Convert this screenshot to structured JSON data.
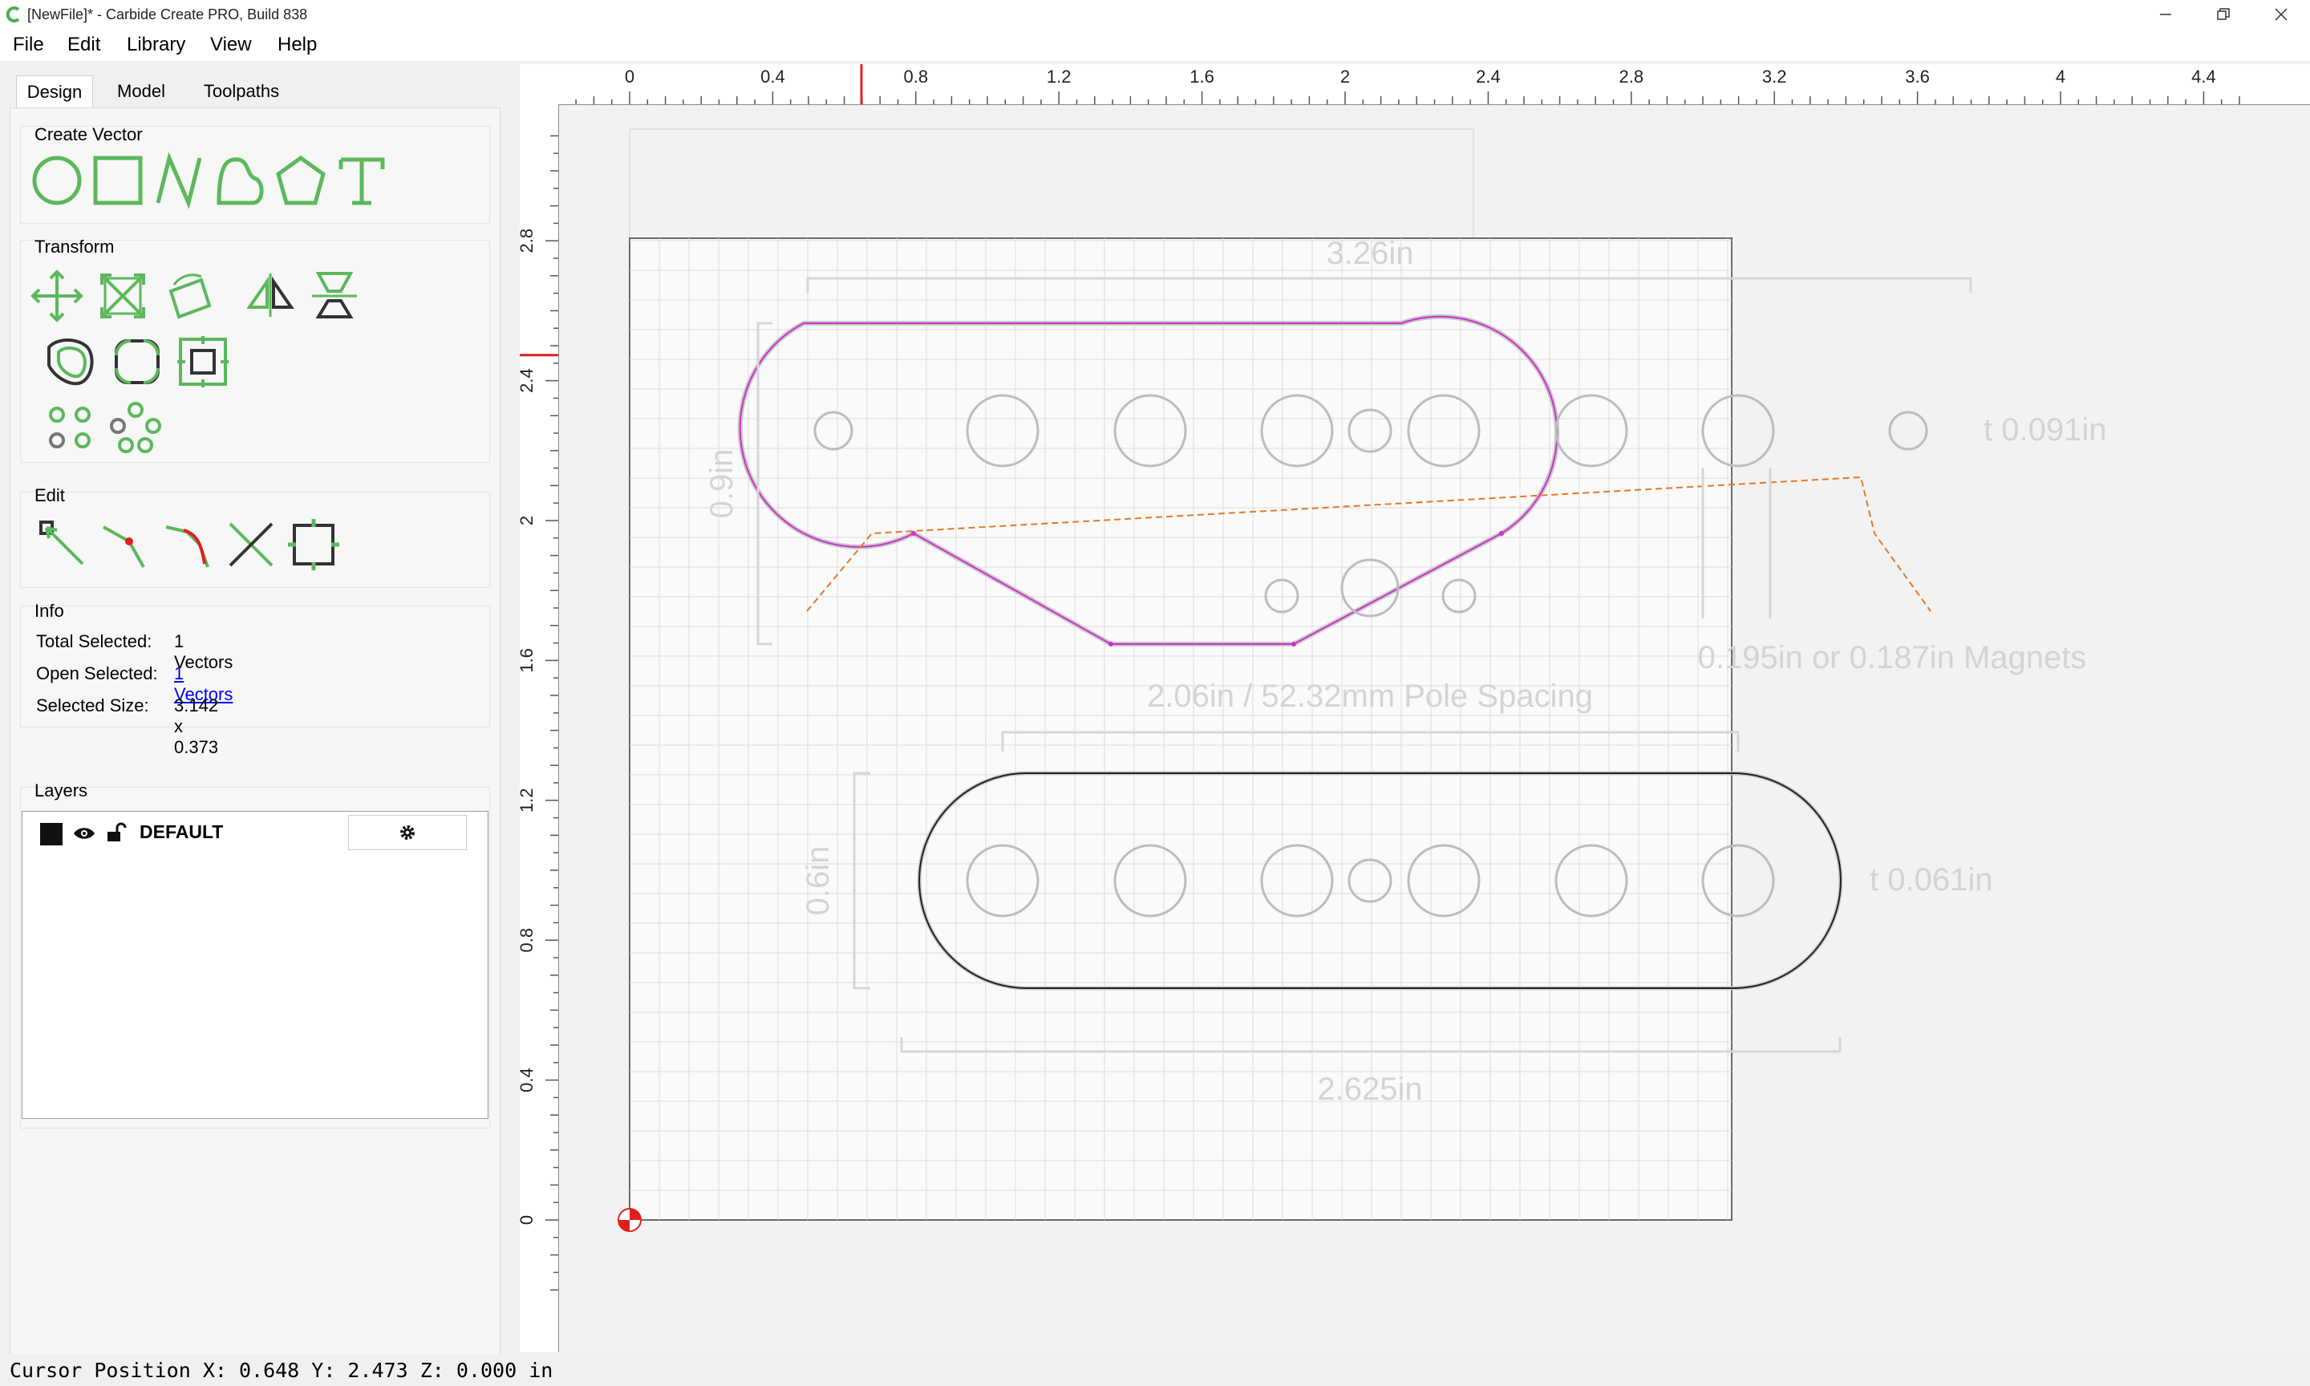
{
  "window": {
    "title": "[NewFile]* - Carbide Create PRO, Build 838"
  },
  "menu": [
    "File",
    "Edit",
    "Library",
    "View",
    "Help"
  ],
  "tabs": [
    "Design",
    "Model",
    "Toolpaths"
  ],
  "sections": {
    "create_vector": "Create Vector",
    "transform": "Transform",
    "edit": "Edit",
    "info": "Info",
    "layers": "Layers"
  },
  "info": {
    "total_selected_label": "Total Selected:",
    "total_selected_value": "1 Vectors",
    "open_selected_label": "Open Selected:",
    "open_selected_value": "1 Vectors",
    "selected_size_label": "Selected Size:",
    "selected_size_value": "3.142 x 0.373"
  },
  "layers": {
    "default_name": "DEFAULT"
  },
  "ruler": {
    "top_labels": [
      "0",
      "0.4",
      "0.8",
      "1.2",
      "1.6",
      "2",
      "2.4",
      "2.8",
      "3.2",
      "3.6",
      "4",
      "4.4"
    ],
    "left_labels": [
      "2.8",
      "2.4",
      "2",
      "1.6",
      "1.2",
      "0.8",
      "0.4",
      "0"
    ]
  },
  "cursor_marker": {
    "x": 0.648,
    "y": 2.473
  },
  "canvas_annotations": {
    "width_top": "3.26in",
    "height_top": "0.9in",
    "thickness_top": "t 0.091in",
    "magnets": "0.195in or 0.187in Magnets",
    "pole_spacing": "2.06in / 52.32mm Pole Spacing",
    "height_bottom": "0.6in",
    "thickness_bottom": "t 0.061in",
    "width_bottom": "2.625in"
  },
  "status": {
    "text": "Cursor Position X: 0.648 Y: 2.473 Z: 0.000 in"
  },
  "colors": {
    "icon_green": "#5cb85c",
    "selection": "#cc33cc",
    "offset_line": "#e87722",
    "ruler_marker": "#e02020",
    "link": "#0000ee"
  }
}
